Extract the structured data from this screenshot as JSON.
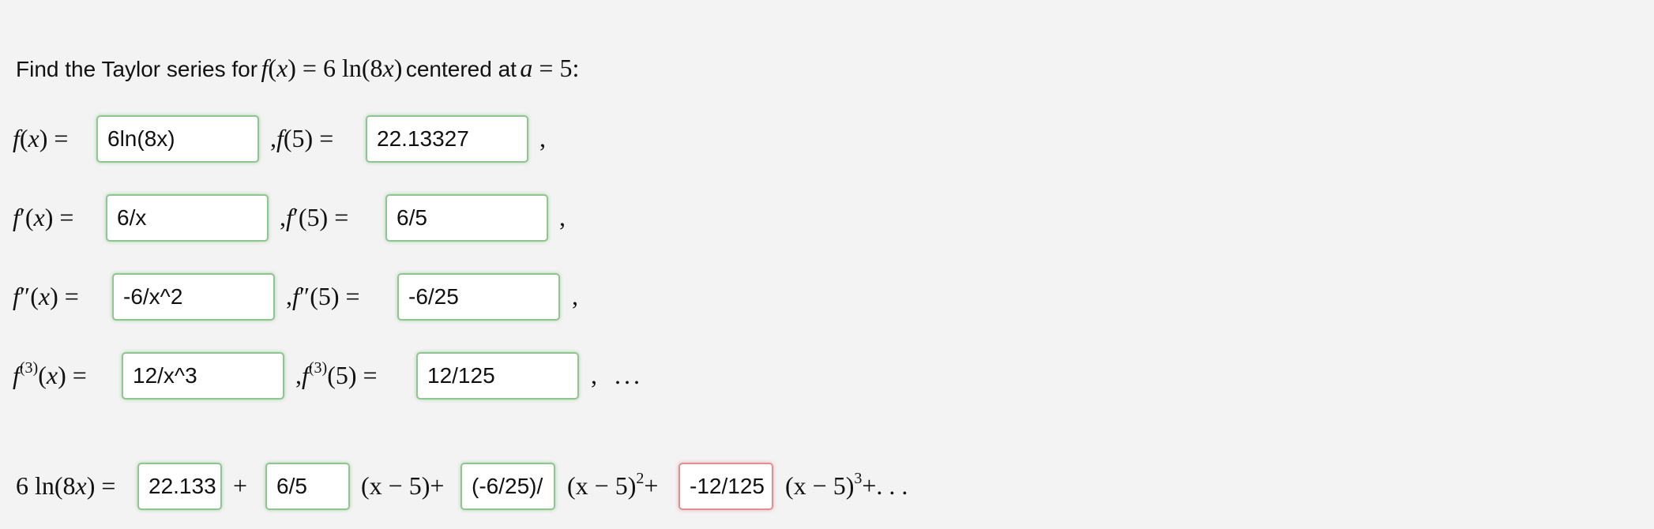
{
  "prompt": {
    "lead_text": "Find the Taylor series for",
    "func_name": "f",
    "func_var": "x",
    "func_rhs": "= 6 ln(8",
    "func_var2": "x",
    "func_close": ")",
    "mid_text": "centered at",
    "center_var": "a",
    "center_rhs": "= 5:",
    "center_colon": ":"
  },
  "rows": [
    {
      "lhs_f": "f",
      "lhs_prime": "",
      "lhs_sup": "",
      "lhs_var": "x",
      "input_value": "6ln(8x)",
      "eval_f": "f",
      "eval_prime": "",
      "eval_sup": "",
      "eval_at": "5",
      "eval_value": "22.13327",
      "trail": ","
    },
    {
      "lhs_f": "f",
      "lhs_prime": "′",
      "lhs_sup": "",
      "lhs_var": "x",
      "input_value": "6/x",
      "eval_f": "f",
      "eval_prime": "′",
      "eval_sup": "",
      "eval_at": "5",
      "eval_value": "6/5",
      "trail": ","
    },
    {
      "lhs_f": "f",
      "lhs_prime": "″",
      "lhs_sup": "",
      "lhs_var": "x",
      "input_value": "-6/x^2",
      "eval_f": "f",
      "eval_prime": "″",
      "eval_sup": "",
      "eval_at": "5",
      "eval_value": "-6/25",
      "trail": ","
    },
    {
      "lhs_f": "f",
      "lhs_prime": "",
      "lhs_sup": "(3)",
      "lhs_var": "x",
      "input_value": "12/x^3",
      "eval_f": "f",
      "eval_prime": "",
      "eval_sup": "(3)",
      "eval_at": "5",
      "eval_value": "12/125",
      "trail": ",",
      "ellipsis": "..."
    }
  ],
  "series": {
    "lhs": "6 ln(8",
    "lhs_var": "x",
    "lhs_close": ") =",
    "term0_value": "22.133",
    "plus": "+",
    "term1_value": "6/5",
    "factor1": "(x − 5)+",
    "term2_value": "(-6/25)/",
    "factor2_base": "(x − 5)",
    "factor2_exp": "2",
    "factor2_plus": "+",
    "term3_value": "-12/125",
    "factor3_base": "(x − 5)",
    "factor3_exp": "3",
    "factor3_tail": "+. . ."
  },
  "colors": {
    "background": "#f3f3f3",
    "input_ok_border": "#8fc58f",
    "input_error_border": "#e28f8f"
  }
}
